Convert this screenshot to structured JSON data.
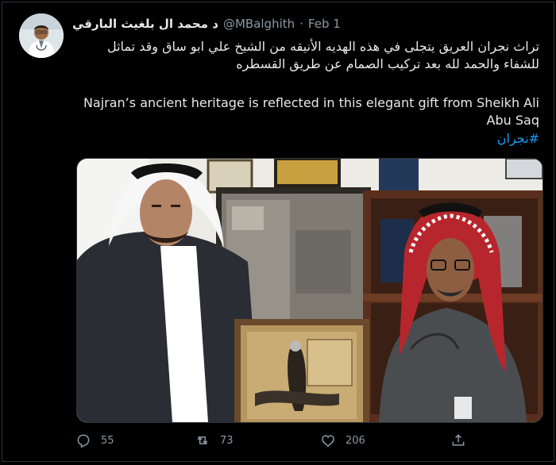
{
  "tweet": {
    "author_name": "د محمد ال بلغيث البارقي",
    "handle": "@MBalghith",
    "separator": "·",
    "date": "Feb 1",
    "arabic_text": "تراث نجران العريق يتجلى في هذه الهديه الأنيقه من الشيخ علي ابو ساق وقد تماثل للشفاء والحمد لله بعد تركيب الصمام عن طريق القسطره",
    "english_text": "Najran’s ancient heritage is reflected in this elegant gift from Sheikh Ali Abu Saq",
    "hashtag": "#نجران"
  },
  "actions": {
    "replies": "55",
    "retweets": "73",
    "likes": "206"
  },
  "icons": {
    "reply": "reply-icon",
    "retweet": "retweet-icon",
    "like": "heart-icon",
    "share": "share-icon"
  },
  "colors": {
    "background": "#000000",
    "text": "#e7e9ea",
    "muted": "#8b98a5",
    "link": "#1d9bf0"
  }
}
